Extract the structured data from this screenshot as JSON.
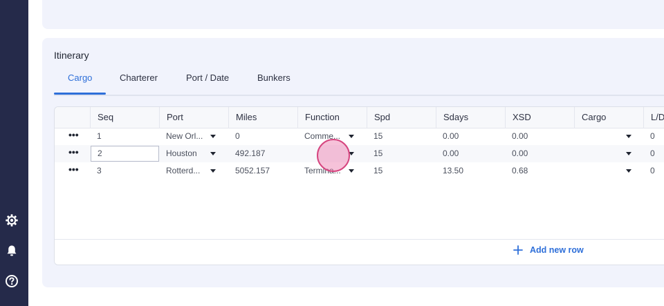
{
  "sidebar": {
    "icons": [
      "gear-icon",
      "bell-icon",
      "help-icon"
    ]
  },
  "section": {
    "title": "Itinerary"
  },
  "tabs": [
    {
      "label": "Cargo",
      "active": true
    },
    {
      "label": "Charterer",
      "active": false
    },
    {
      "label": "Port / Date",
      "active": false
    },
    {
      "label": "Bunkers",
      "active": false
    }
  ],
  "grid": {
    "columns": [
      "Seq",
      "Port",
      "Miles",
      "Function",
      "Spd",
      "Sdays",
      "XSD",
      "Cargo",
      "L/D"
    ],
    "rows": [
      {
        "seq": "1",
        "port": "New Orl...",
        "miles": "0",
        "function": "Comme...",
        "spd": "15",
        "sdays": "0.00",
        "xsd": "0.00",
        "cargo": "",
        "ld": "0"
      },
      {
        "seq": "2",
        "port": "Houston",
        "miles": "492.187",
        "function": "",
        "spd": "15",
        "sdays": "0.00",
        "xsd": "0.00",
        "cargo": "",
        "ld": "0"
      },
      {
        "seq": "3",
        "port": "Rotterd...",
        "miles": "5052.157",
        "function": "Termina...",
        "spd": "15",
        "sdays": "13.50",
        "xsd": "0.68",
        "cargo": "",
        "ld": "0"
      }
    ],
    "row_menu": "•••",
    "add_row_label": "Add new row"
  },
  "colors": {
    "sidebar": "#252a4a",
    "accent": "#2e6fd9",
    "card_bg": "#f1f3fc"
  }
}
